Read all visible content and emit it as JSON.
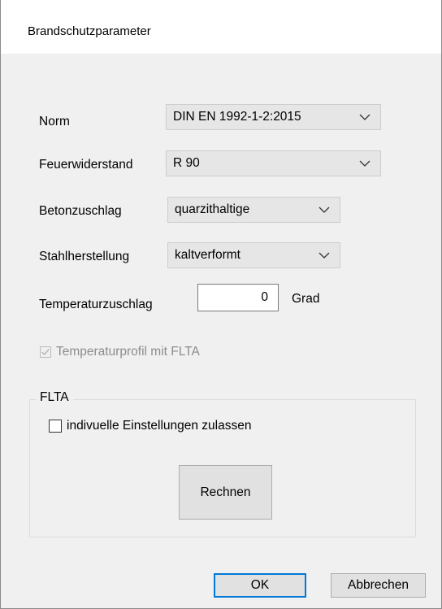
{
  "window": {
    "title": "Brandschutzparameter"
  },
  "form": {
    "norm": {
      "label": "Norm",
      "value": "DIN EN 1992-1-2:2015"
    },
    "feuerwiderstand": {
      "label": "Feuerwiderstand",
      "value": "R 90"
    },
    "betonzuschlag": {
      "label": "Betonzuschlag",
      "value": "quarzithaltige"
    },
    "stahlherstellung": {
      "label": "Stahlherstellung",
      "value": "kaltverformt"
    },
    "temperaturzuschlag": {
      "label": "Temperaturzuschlag",
      "value": "0",
      "unit": "Grad"
    },
    "temperaturprofil": {
      "label": "Temperaturprofil mit FLTA",
      "checked": true,
      "enabled": false
    }
  },
  "flta_group": {
    "title": "FLTA",
    "individual_settings": {
      "label": "indivuelle Einstellungen zulassen",
      "checked": false
    },
    "calculate_button": "Rechnen"
  },
  "footer": {
    "ok_label": "OK",
    "cancel_label": "Abbrechen"
  },
  "colors": {
    "dialog_background": "#f0f0f0",
    "combo_background": "#e6e6e6",
    "default_button_border": "#0078d7",
    "disabled_text": "#8c8c8c"
  }
}
